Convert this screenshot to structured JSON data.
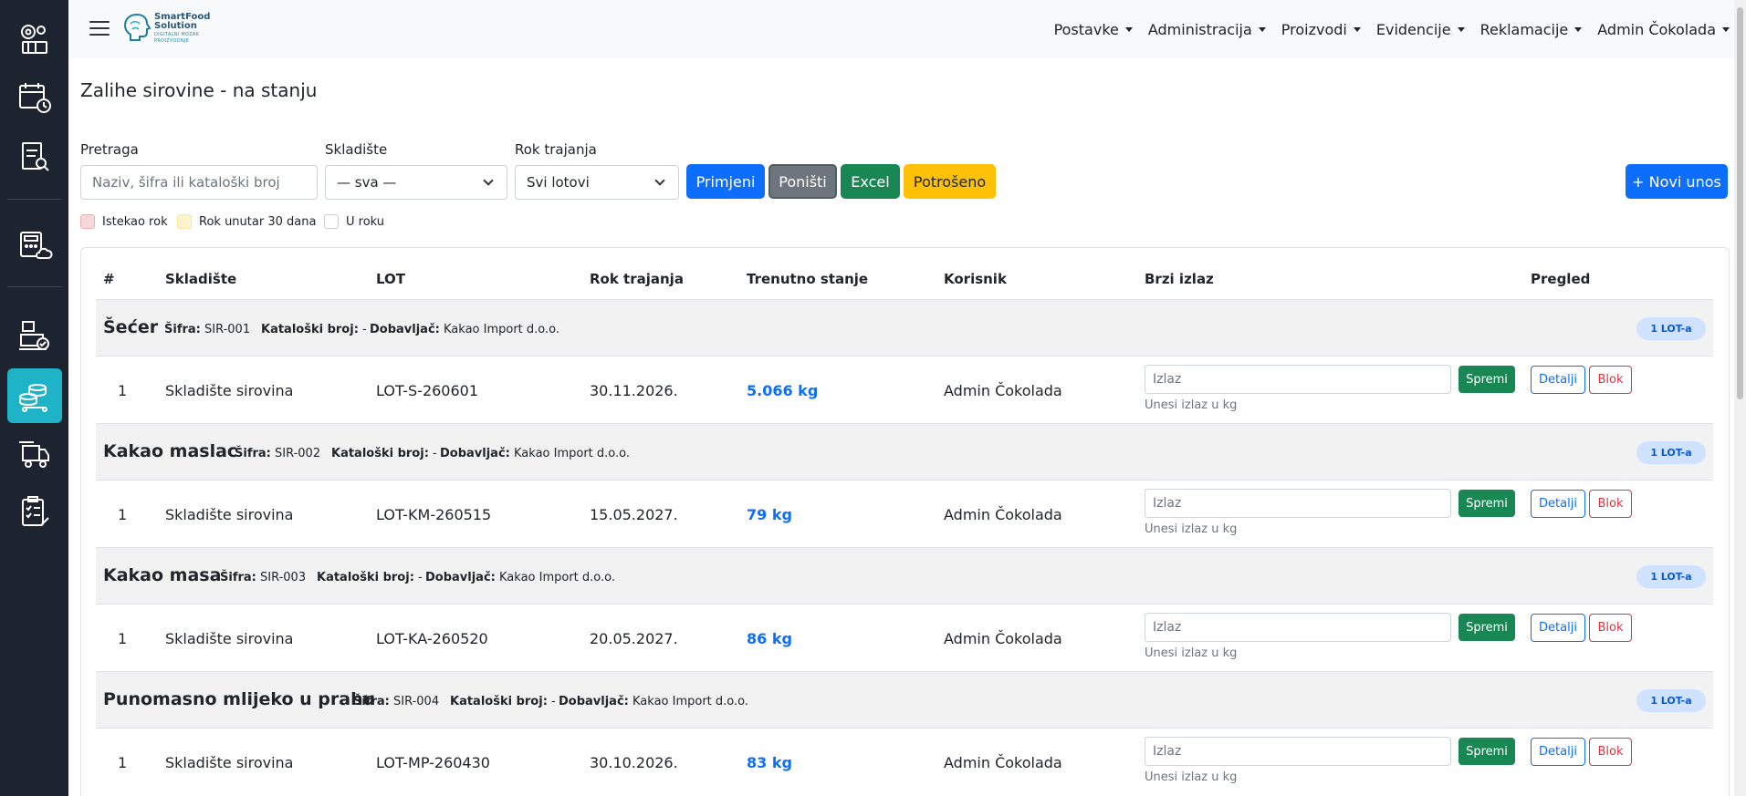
{
  "app": {
    "brand_title_line1": "SmartFood",
    "brand_title_line2": "Solution",
    "brand_sub_line1": "DIGITALNI MOZAK",
    "brand_sub_line2": "PROIZVODNJE"
  },
  "sidebar": {
    "items": [
      {
        "icon": "factory-gears-icon",
        "active": false
      },
      {
        "icon": "calendar-clock-icon",
        "active": false
      },
      {
        "icon": "report-search-icon",
        "active": false
      },
      {
        "icon": "calculator-cloud-icon",
        "active": false
      },
      {
        "icon": "boxes-check-icon",
        "active": false
      },
      {
        "icon": "warehouse-stock-icon",
        "active": true
      },
      {
        "icon": "delivery-truck-icon",
        "active": false
      },
      {
        "icon": "checklist-clipboard-icon",
        "active": false
      }
    ],
    "active_color": "#1fb3c8"
  },
  "navbar": {
    "menu": [
      "Postavke",
      "Administracija",
      "Proizvodi",
      "Evidencije",
      "Reklamacije",
      "Admin Čokolada"
    ]
  },
  "page": {
    "title": "Zalihe sirovine - na stanju"
  },
  "filters": {
    "search_label": "Pretraga",
    "search_placeholder": "Naziv, šifra ili kataloški broj",
    "warehouse_label": "Skladište",
    "warehouse_value": "— sva —",
    "expiry_label": "Rok trajanja",
    "expiry_value": "Svi lotovi",
    "apply": "Primjeni",
    "reset": "Poništi",
    "excel": "Excel",
    "consumed": "Potrošeno",
    "new_entry": "+ Novi unos"
  },
  "legend": {
    "expired": "Istekao rok",
    "within30": "Rok unutar 30 dana",
    "ok": "U roku",
    "colors": {
      "expired": "#f8d7da",
      "within30": "#fff3cd",
      "ok": "#ffffff"
    }
  },
  "table": {
    "headers": [
      "#",
      "Skladište",
      "LOT",
      "Rok trajanja",
      "Trenutno stanje",
      "Korisnik",
      "Brzi izlaz",
      "Pregled"
    ],
    "sifra_label": "Šifra:",
    "katalog_label": "Kataloški broj:",
    "dobavljac_label": "Dobavljač:",
    "exit_placeholder": "Izlaz",
    "exit_hint": "Unesi izlaz u kg",
    "save": "Spremi",
    "details": "Detalji",
    "block": "Blok",
    "groups": [
      {
        "name": "Šećer",
        "sifra": "SIR-001",
        "katalog": "-",
        "dobavljac": "Kakao Import d.o.o.",
        "badge": "1 LOT-a",
        "row": {
          "num": "1",
          "warehouse": "Skladište sirovina",
          "lot": "LOT-S-260601",
          "expiry": "30.11.2026.",
          "qty": "5.066 kg",
          "user": "Admin Čokolada"
        }
      },
      {
        "name": "Kakao maslac",
        "sifra": "SIR-002",
        "katalog": "-",
        "dobavljac": "Kakao Import d.o.o.",
        "badge": "1 LOT-a",
        "row": {
          "num": "1",
          "warehouse": "Skladište sirovina",
          "lot": "LOT-KM-260515",
          "expiry": "15.05.2027.",
          "qty": "79 kg",
          "user": "Admin Čokolada"
        }
      },
      {
        "name": "Kakao masa",
        "sifra": "SIR-003",
        "katalog": "-",
        "dobavljac": "Kakao Import d.o.o.",
        "badge": "1 LOT-a",
        "row": {
          "num": "1",
          "warehouse": "Skladište sirovina",
          "lot": "LOT-KA-260520",
          "expiry": "20.05.2027.",
          "qty": "86 kg",
          "user": "Admin Čokolada"
        }
      },
      {
        "name": "Punomasno mlijeko u prahu",
        "sifra": "SIR-004",
        "katalog": "-",
        "dobavljac": "Kakao Import d.o.o.",
        "badge": "1 LOT-a",
        "row": {
          "num": "1",
          "warehouse": "Skladište sirovina",
          "lot": "LOT-MP-260430",
          "expiry": "30.10.2026.",
          "qty": "83 kg",
          "user": "Admin Čokolada"
        }
      }
    ]
  }
}
